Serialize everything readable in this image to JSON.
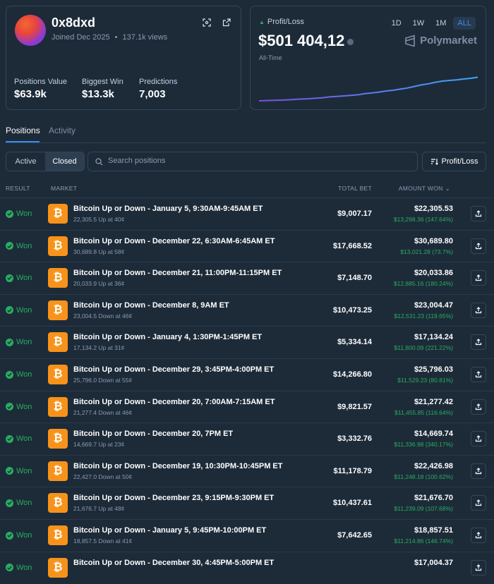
{
  "profile": {
    "username": "0x8dxd",
    "joined": "Joined Dec 2025",
    "views": "137.1k views",
    "separator": "•",
    "stats": [
      {
        "label": "Positions Value",
        "value": "$63.9k"
      },
      {
        "label": "Biggest Win",
        "value": "$13.3k"
      },
      {
        "label": "Predictions",
        "value": "7,003"
      }
    ]
  },
  "pnl": {
    "label": "Profit/Loss",
    "value": "$501 404,12",
    "period": "All-Time",
    "ranges": [
      "1D",
      "1W",
      "1M",
      "ALL"
    ],
    "active_range": "ALL",
    "brand": "Polymarket"
  },
  "tabs": [
    "Positions",
    "Activity"
  ],
  "filters": {
    "segments": [
      "Active",
      "Closed"
    ],
    "active_segment": "Closed",
    "search_placeholder": "Search positions",
    "sort_label": "Profit/Loss"
  },
  "columns": {
    "result": "RESULT",
    "market": "MARKET",
    "total_bet": "TOTAL BET",
    "amount_won": "AMOUNT WON"
  },
  "positions": [
    {
      "result": "Won",
      "title": "Bitcoin Up or Down - January 5, 9:30AM-9:45AM ET",
      "sub": "22,305.5 Up at 40¢",
      "total_bet": "$9,007.17",
      "amount_won": "$22,305.53",
      "gain": "$13,298.36 (147.64%)"
    },
    {
      "result": "Won",
      "title": "Bitcoin Up or Down - December 22, 6:30AM-6:45AM ET",
      "sub": "30,689.8 Up at 58¢",
      "total_bet": "$17,668.52",
      "amount_won": "$30,689.80",
      "gain": "$13,021.28 (73.7%)"
    },
    {
      "result": "Won",
      "title": "Bitcoin Up or Down - December 21, 11:00PM-11:15PM ET",
      "sub": "20,033.9 Up at 36¢",
      "total_bet": "$7,148.70",
      "amount_won": "$20,033.86",
      "gain": "$12,885.16 (180.24%)"
    },
    {
      "result": "Won",
      "title": "Bitcoin Up or Down - December 8, 9AM ET",
      "sub": "23,004.5 Down at 46¢",
      "total_bet": "$10,473.25",
      "amount_won": "$23,004.47",
      "gain": "$12,531.23 (119.65%)"
    },
    {
      "result": "Won",
      "title": "Bitcoin Up or Down - January 4, 1:30PM-1:45PM ET",
      "sub": "17,134.2 Up at 31¢",
      "total_bet": "$5,334.14",
      "amount_won": "$17,134.24",
      "gain": "$11,800.09 (221.22%)"
    },
    {
      "result": "Won",
      "title": "Bitcoin Up or Down - December 29, 3:45PM-4:00PM ET",
      "sub": "25,796.0 Down at 55¢",
      "total_bet": "$14,266.80",
      "amount_won": "$25,796.03",
      "gain": "$11,529.23 (80.81%)"
    },
    {
      "result": "Won",
      "title": "Bitcoin Up or Down - December 20, 7:00AM-7:15AM ET",
      "sub": "21,277.4 Down at 46¢",
      "total_bet": "$9,821.57",
      "amount_won": "$21,277.42",
      "gain": "$11,455.85 (116.64%)"
    },
    {
      "result": "Won",
      "title": "Bitcoin Up or Down - December 20, 7PM ET",
      "sub": "14,669.7 Up at 23¢",
      "total_bet": "$3,332.76",
      "amount_won": "$14,669.74",
      "gain": "$11,336.98 (340.17%)"
    },
    {
      "result": "Won",
      "title": "Bitcoin Up or Down - December 19, 10:30PM-10:45PM ET",
      "sub": "22,427.0 Down at 50¢",
      "total_bet": "$11,178.79",
      "amount_won": "$22,426.98",
      "gain": "$11,248.18 (100.62%)"
    },
    {
      "result": "Won",
      "title": "Bitcoin Up or Down - December 23, 9:15PM-9:30PM ET",
      "sub": "21,676.7 Up at 48¢",
      "total_bet": "$10,437.61",
      "amount_won": "$21,676.70",
      "gain": "$11,239.09 (107.68%)"
    },
    {
      "result": "Won",
      "title": "Bitcoin Up or Down - January 5, 9:45PM-10:00PM ET",
      "sub": "18,857.5 Down at 41¢",
      "total_bet": "$7,642.65",
      "amount_won": "$18,857.51",
      "gain": "$11,214.86 (146.74%)"
    },
    {
      "result": "Won",
      "title": "Bitcoin Up or Down - December 30, 4:45PM-5:00PM ET",
      "sub": "",
      "total_bet": "",
      "amount_won": "$17,004.37",
      "gain": ""
    }
  ],
  "colors": {
    "accent": "#3b8cf0",
    "positive": "#27ae60",
    "bitcoin": "#f7931a",
    "bg": "#1d2b39"
  }
}
